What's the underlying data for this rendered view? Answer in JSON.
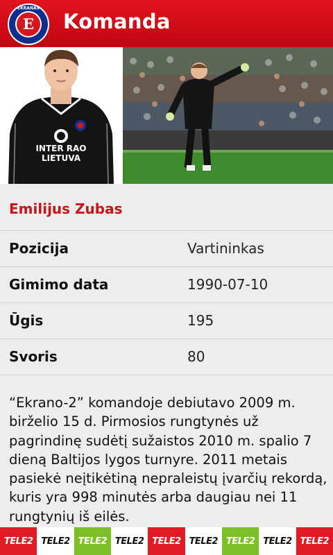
{
  "app": {
    "title": "Komanda",
    "logo_text": "EKRANAS",
    "logo_letter": "E"
  },
  "player": {
    "name": "Emilijus Zubas",
    "shirt_sponsor_line1": "INTER RAO",
    "shirt_sponsor_line2": "LIETUVA"
  },
  "details": [
    {
      "label": "Pozicija",
      "value": "Vartininkas"
    },
    {
      "label": "Gimimo data",
      "value": "1990-07-10"
    },
    {
      "label": "Ūgis",
      "value": "195"
    },
    {
      "label": "Svoris",
      "value": "80"
    }
  ],
  "bio": "“Ekrano-2” komandoje debiutavo 2009 m. birželio 15 d. Pirmosios rungtynės už pagrindinę sudėtį sužaistos 2010 m. spalio 7 dieną Baltijos lygos turnyre. 2011 metais pasiekė neįtikėtiną nepraleistų įvarčių rekordą, kuris yra 998 minutės arba daugiau nei 11 rungtynių iš eilės.",
  "sponsor": {
    "label": "TELE2",
    "tile_colors": [
      "#e01b23",
      "#ffffff",
      "#7cc028",
      "#ffffff",
      "#e01b23",
      "#ffffff",
      "#7cc028",
      "#ffffff",
      "#e01b23"
    ]
  },
  "colors": {
    "brand_red": "#d10c16",
    "name_red": "#cc1119",
    "detail_bg": "#ededed"
  }
}
